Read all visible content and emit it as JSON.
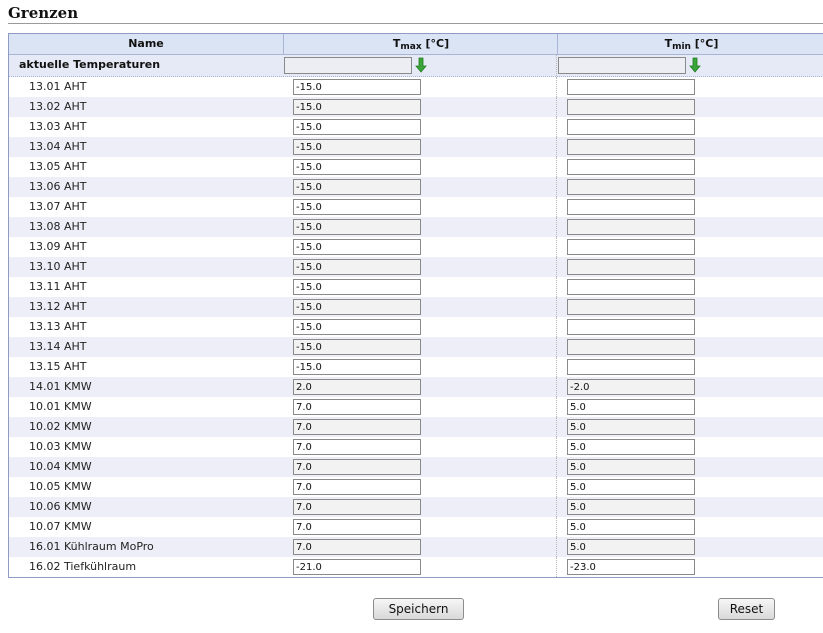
{
  "page": {
    "title": "Grenzen"
  },
  "table": {
    "headers": {
      "name": "Name",
      "tmax_T": "T",
      "tmax_sub": "max",
      "tmax_unit": " [°C]",
      "tmin_T": "T",
      "tmin_sub": "min",
      "tmin_unit": " [°C]"
    },
    "aggregate": {
      "label": "aktuelle Temperaturen",
      "tmax": "",
      "tmin": "",
      "arrow_icon": "green-down-arrow-icon"
    },
    "rows": [
      {
        "name": "13.01 AHT",
        "tmax": "-15.0",
        "tmin": ""
      },
      {
        "name": "13.02 AHT",
        "tmax": "-15.0",
        "tmin": ""
      },
      {
        "name": "13.03 AHT",
        "tmax": "-15.0",
        "tmin": ""
      },
      {
        "name": "13.04 AHT",
        "tmax": "-15.0",
        "tmin": ""
      },
      {
        "name": "13.05 AHT",
        "tmax": "-15.0",
        "tmin": ""
      },
      {
        "name": "13.06 AHT",
        "tmax": "-15.0",
        "tmin": ""
      },
      {
        "name": "13.07 AHT",
        "tmax": "-15.0",
        "tmin": ""
      },
      {
        "name": "13.08 AHT",
        "tmax": "-15.0",
        "tmin": ""
      },
      {
        "name": "13.09 AHT",
        "tmax": "-15.0",
        "tmin": ""
      },
      {
        "name": "13.10 AHT",
        "tmax": "-15.0",
        "tmin": ""
      },
      {
        "name": "13.11 AHT",
        "tmax": "-15.0",
        "tmin": ""
      },
      {
        "name": "13.12 AHT",
        "tmax": "-15.0",
        "tmin": ""
      },
      {
        "name": "13.13 AHT",
        "tmax": "-15.0",
        "tmin": ""
      },
      {
        "name": "13.14 AHT",
        "tmax": "-15.0",
        "tmin": ""
      },
      {
        "name": "13.15 AHT",
        "tmax": "-15.0",
        "tmin": ""
      },
      {
        "name": "14.01 KMW",
        "tmax": "2.0",
        "tmin": "-2.0"
      },
      {
        "name": "10.01 KMW",
        "tmax": "7.0",
        "tmin": "5.0"
      },
      {
        "name": "10.02 KMW",
        "tmax": "7.0",
        "tmin": "5.0"
      },
      {
        "name": "10.03 KMW",
        "tmax": "7.0",
        "tmin": "5.0"
      },
      {
        "name": "10.04 KMW",
        "tmax": "7.0",
        "tmin": "5.0"
      },
      {
        "name": "10.05 KMW",
        "tmax": "7.0",
        "tmin": "5.0"
      },
      {
        "name": "10.06 KMW",
        "tmax": "7.0",
        "tmin": "5.0"
      },
      {
        "name": "10.07 KMW",
        "tmax": "7.0",
        "tmin": "5.0"
      },
      {
        "name": "16.01 Kühlraum MoPro",
        "tmax": "7.0",
        "tmin": "5.0"
      },
      {
        "name": "16.02 Tiefkühlraum",
        "tmax": "-21.0",
        "tmin": "-23.0"
      }
    ]
  },
  "buttons": {
    "save": "Speichern",
    "reset": "Reset"
  },
  "colors": {
    "header_bg": "#dbe4f5",
    "alt_row_bg": "#eeeef8",
    "arrow": "#2e9e2e"
  }
}
